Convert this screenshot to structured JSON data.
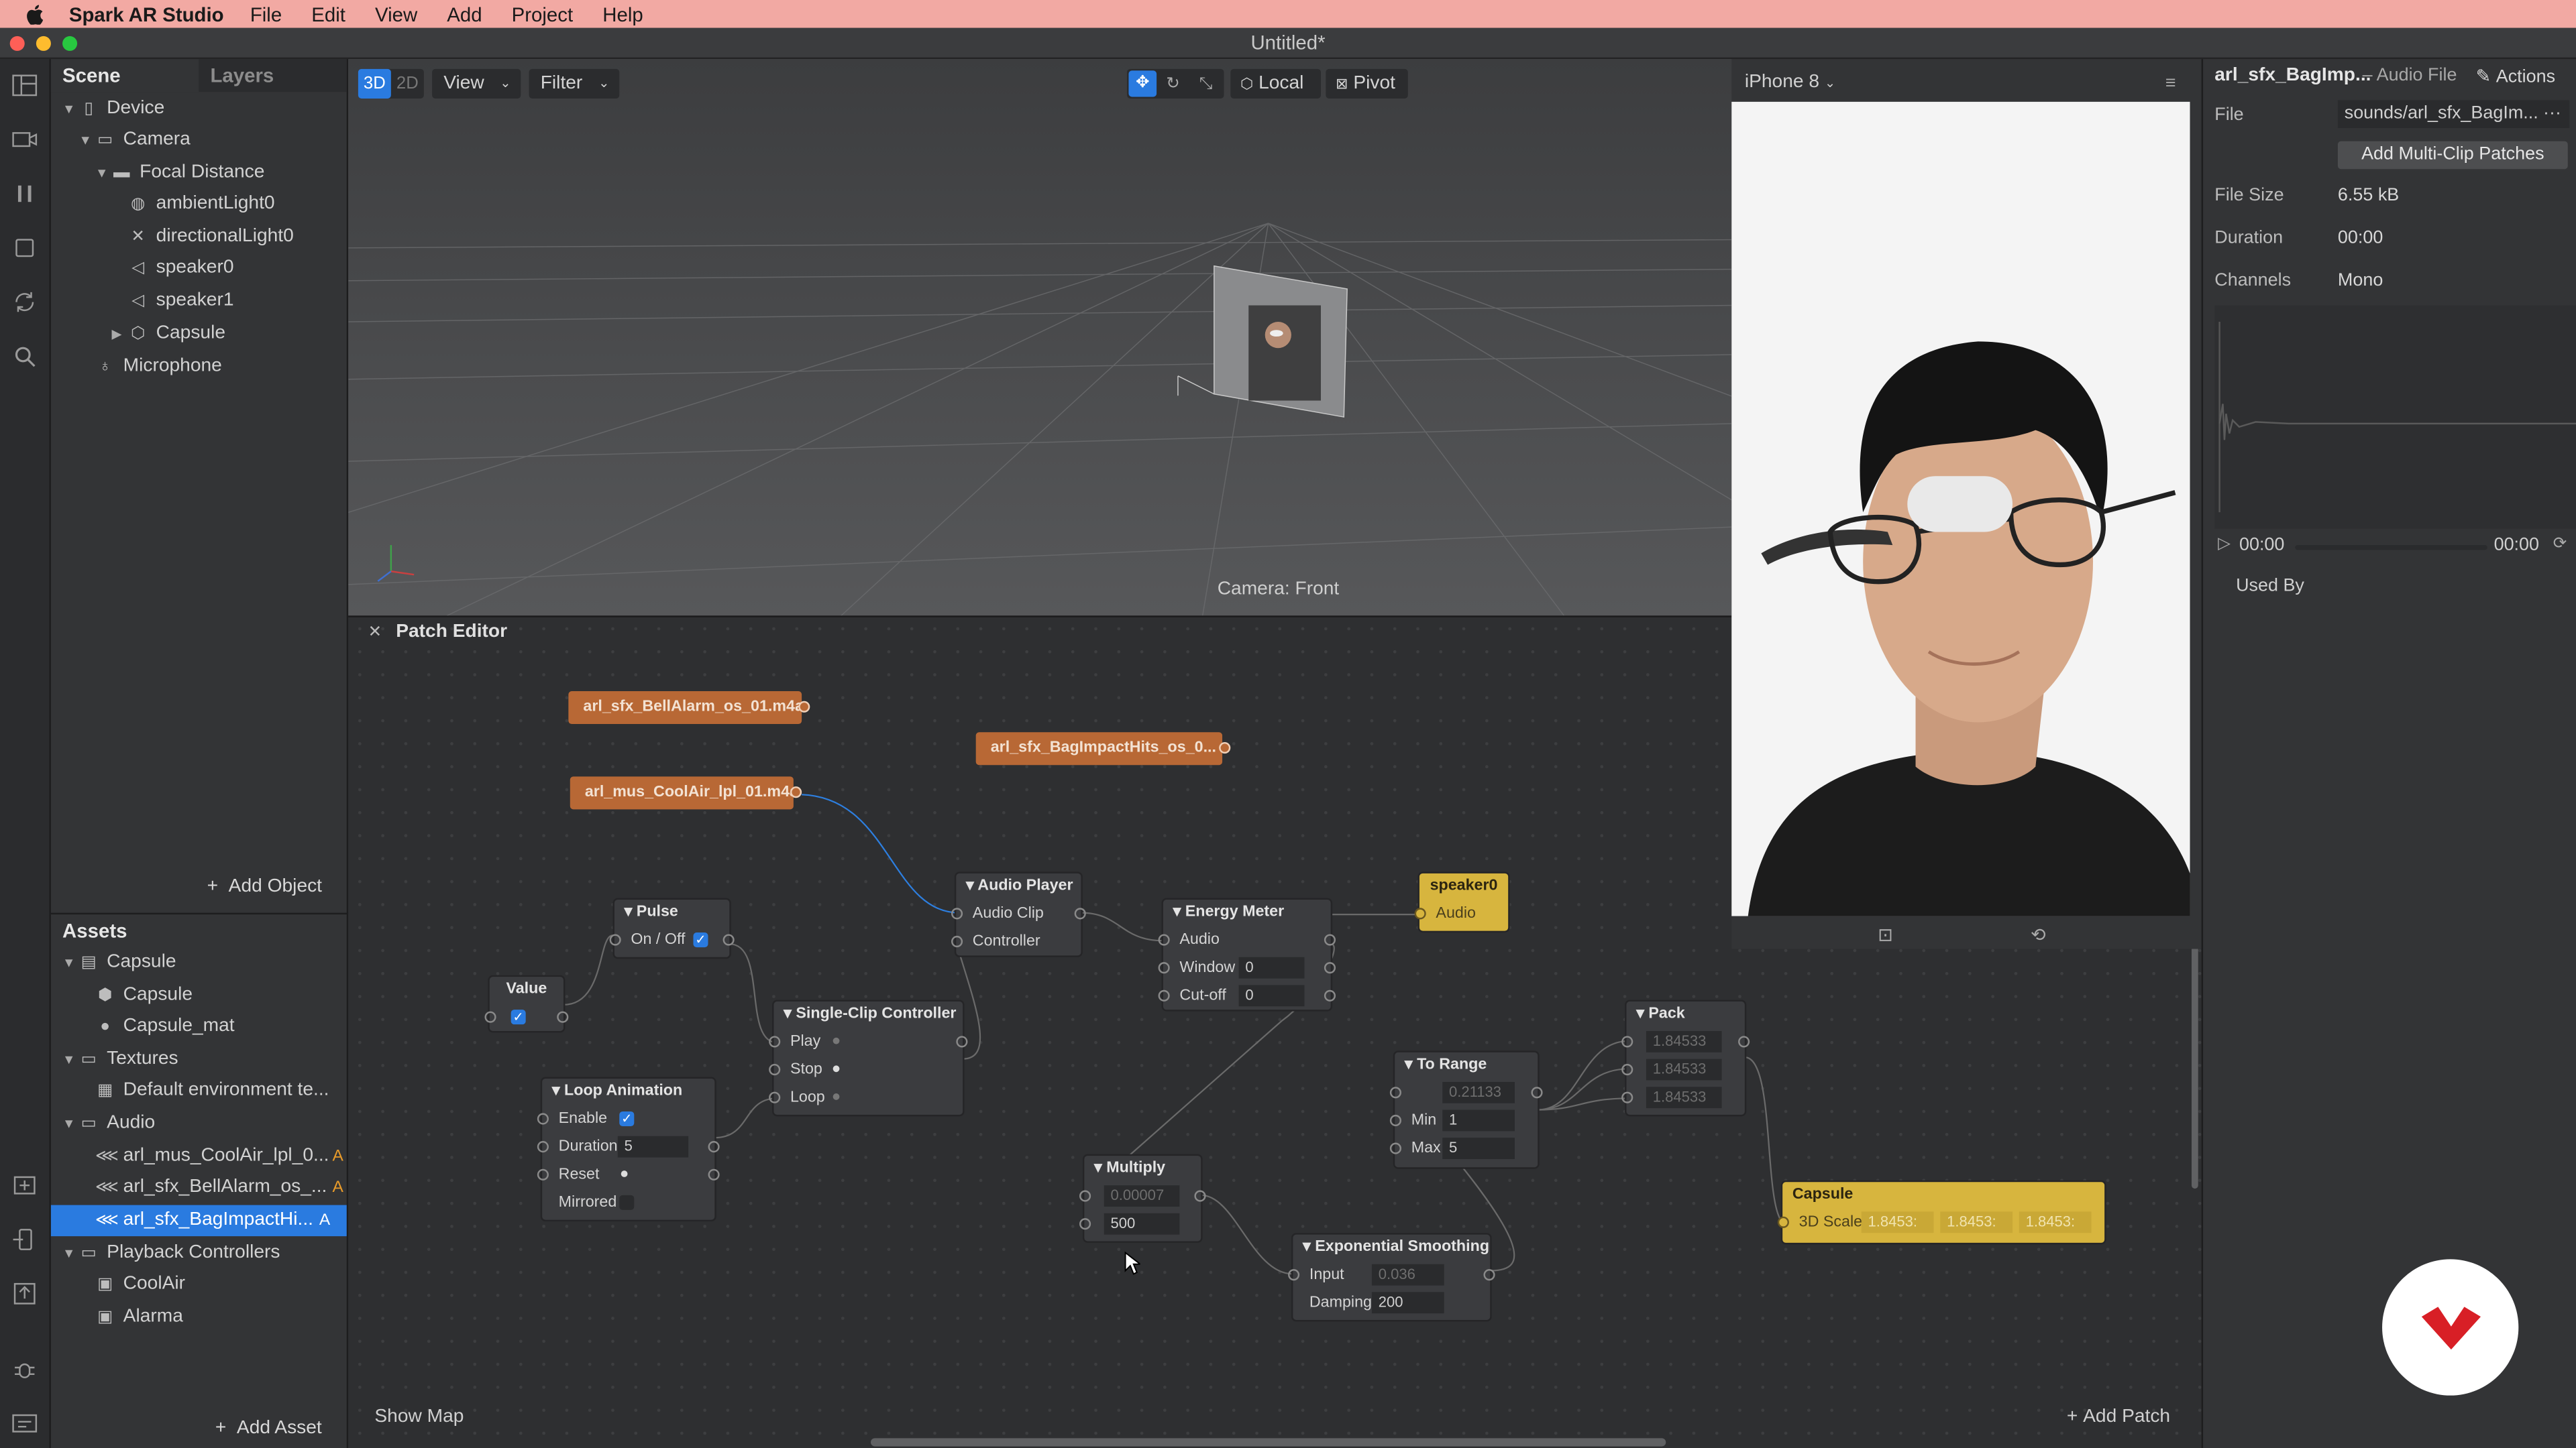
{
  "menubar": {
    "app_name": "Spark AR Studio",
    "items": [
      "File",
      "Edit",
      "View",
      "Add",
      "Project",
      "Help"
    ]
  },
  "window": {
    "title": "Untitled*"
  },
  "scene_panel": {
    "tabs": [
      "Scene",
      "Layers"
    ],
    "tree": [
      {
        "label": "Device",
        "icon": "device-icon",
        "level": 0,
        "expanded": true
      },
      {
        "label": "Camera",
        "icon": "camera-icon",
        "level": 1,
        "expanded": true
      },
      {
        "label": "Focal Distance",
        "icon": "focal-distance-icon",
        "level": 2,
        "expanded": true
      },
      {
        "label": "ambientLight0",
        "icon": "ambient-light-icon",
        "level": 3
      },
      {
        "label": "directionalLight0",
        "icon": "directional-light-icon",
        "level": 3
      },
      {
        "label": "speaker0",
        "icon": "speaker-icon",
        "level": 3,
        "linked": true
      },
      {
        "label": "speaker1",
        "icon": "speaker-icon",
        "level": 3
      },
      {
        "label": "Capsule",
        "icon": "cube-icon",
        "level": 3,
        "collapsed": true,
        "linked": true
      },
      {
        "label": "Microphone",
        "icon": "microphone-icon",
        "level": 1
      }
    ],
    "add_object": "Add Object"
  },
  "assets_panel": {
    "title": "Assets",
    "tree": [
      {
        "label": "Capsule",
        "icon": "file-icon",
        "level": 0,
        "expanded": true
      },
      {
        "label": "Capsule",
        "icon": "mesh-icon",
        "level": 1
      },
      {
        "label": "Capsule_mat",
        "icon": "material-icon",
        "level": 1
      },
      {
        "label": "Textures",
        "icon": "folder-icon",
        "level": 0,
        "expanded": true
      },
      {
        "label": "Default environment te...",
        "icon": "texture-icon",
        "level": 1
      },
      {
        "label": "Audio",
        "icon": "folder-icon",
        "level": 0,
        "expanded": true
      },
      {
        "label": "arl_mus_CoolAir_lpl_0...",
        "icon": "audio-icon",
        "level": 1,
        "badge": "A"
      },
      {
        "label": "arl_sfx_BellAlarm_os_...",
        "icon": "audio-icon",
        "level": 1,
        "badge": "A"
      },
      {
        "label": "arl_sfx_BagImpactHi...",
        "icon": "audio-icon",
        "level": 1,
        "badge": "A",
        "selected": true
      },
      {
        "label": "Playback Controllers",
        "icon": "folder-icon",
        "level": 0,
        "expanded": true
      },
      {
        "label": "CoolAir",
        "icon": "controller-icon",
        "level": 1
      },
      {
        "label": "Alarma",
        "icon": "controller-icon",
        "level": 1
      }
    ],
    "add_asset": "Add Asset"
  },
  "viewport": {
    "mode_3d": "3D",
    "mode_2d": "2D",
    "view": "View",
    "filter": "Filter",
    "local": "Local",
    "pivot": "Pivot",
    "camera_label": "Camera: Front"
  },
  "patch_editor": {
    "title": "Patch Editor",
    "show_map": "Show Map",
    "add_patch": "Add Patch",
    "nodes": {
      "bell": "arl_sfx_BellAlarm_os_01.m4a",
      "bag": "arl_sfx_BagImpactHits_os_0...",
      "coolair": "arl_mus_CoolAir_lpl_01.m4a",
      "audio_player": {
        "title": "Audio Player",
        "p1": "Audio Clip",
        "p2": "Controller"
      },
      "energy": {
        "title": "Energy Meter",
        "p1": "Audio",
        "p2": "Window",
        "p2v": "0",
        "p3": "Cut-off",
        "p3v": "0"
      },
      "speaker": {
        "title": "speaker0",
        "p1": "Audio"
      },
      "pulse": {
        "title": "Pulse",
        "p1": "On / Off"
      },
      "value": {
        "title": "Value"
      },
      "single": {
        "title": "Single-Clip Controller",
        "p1": "Play",
        "p2": "Stop",
        "p3": "Loop"
      },
      "loop": {
        "title": "Loop Animation",
        "p1": "Enable",
        "p2": "Duration",
        "p2v": "5",
        "p3": "Reset",
        "p4": "Mirrored"
      },
      "pack": {
        "title": "Pack",
        "v1": "1.84533",
        "v2": "1.84533",
        "v3": "1.84533"
      },
      "torange": {
        "title": "To Range",
        "v0": "0.21133",
        "p1": "Min",
        "p1v": "1",
        "p2": "Max",
        "p2v": "5"
      },
      "multiply": {
        "title": "Multiply",
        "v1": "0.00007",
        "v2": "500"
      },
      "smooth": {
        "title": "Exponential Smoothing",
        "p1": "Input",
        "p1v": "0.036",
        "p2": "Damping",
        "p2v": "200"
      },
      "capsule": {
        "title": "Capsule",
        "p1": "3D Scale",
        "v1": "1.8453:",
        "v2": "1.8453:",
        "v3": "1.8453:"
      }
    }
  },
  "preview": {
    "device": "iPhone 8"
  },
  "inspector": {
    "title": "arl_sfx_BagImp...",
    "type": "– Audio File",
    "actions": "Actions",
    "file_label": "File",
    "file_value": "sounds/arl_sfx_BagIm...",
    "add_multi": "Add Multi-Clip Patches",
    "size_label": "File Size",
    "size_value": "6.55 kB",
    "duration_label": "Duration",
    "duration_value": "00:00",
    "channels_label": "Channels",
    "channels_value": "Mono",
    "time_start": "00:00",
    "time_end": "00:00",
    "used_by": "Used By"
  },
  "colors": {
    "accent": "#2a7be0",
    "asset_node": "#b86835",
    "scene_node": "#d7b53e",
    "menubar": "#f2a9a3"
  }
}
